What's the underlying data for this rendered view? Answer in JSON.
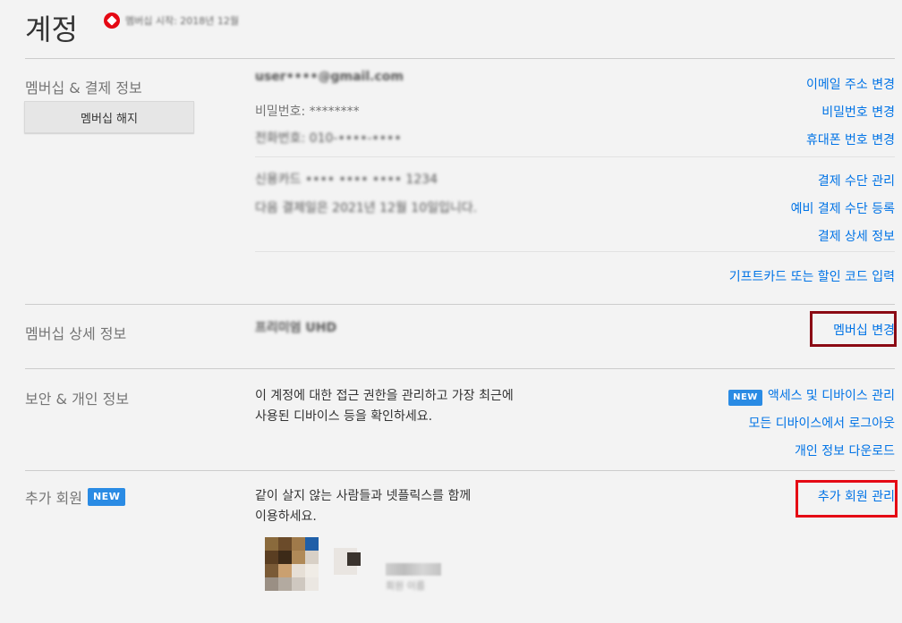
{
  "page": {
    "title": "계정",
    "member_since": "멤버십 시작: 2018년 12월"
  },
  "membership_billing": {
    "label": "멤버십 & 결제 정보",
    "cancel_button": "멤버십 해지",
    "email": "user••••@gmail.com",
    "password": "비밀번호: ********",
    "phone": "전화번호: 010-••••-••••",
    "card": "신용카드 •••• •••• •••• 1234",
    "next_billing": "다음 결제일은 2021년 12월 10일입니다.",
    "links": {
      "change_email": "이메일 주소 변경",
      "change_password": "비밀번호 변경",
      "change_phone": "휴대폰 번호 변경",
      "manage_payment": "결제 수단 관리",
      "backup_payment": "예비 결제 수단 등록",
      "billing_details": "결제 상세 정보",
      "gift_card": "기프트카드 또는 할인 코드 입력"
    }
  },
  "plan_details": {
    "label": "멤버십 상세 정보",
    "plan_value": "프리미엄 UHD",
    "change_plan": "멤버십 변경"
  },
  "security": {
    "label": "보안 & 개인 정보",
    "description_line1": "이 계정에 대한 접근 권한을 관리하고 가장 최근에",
    "description_line2": "사용된 디바이스 등을 확인하세요.",
    "new_badge": "NEW",
    "access_devices": "액세스 및 디바이스 관리",
    "sign_out_all": "모든 디바이스에서 로그아웃",
    "download_info": "개인 정보 다운로드"
  },
  "extra_member": {
    "label": "추가 회원",
    "new_badge": "NEW",
    "description_line1": "같이 살지 않는 사람들과 넷플릭스를 함께",
    "description_line2": "이용하세요.",
    "manage": "추가 회원 관리",
    "profile_name": "회원 이름"
  },
  "colors": {
    "accent_link": "#0073e6",
    "badge": "#2a8be4",
    "highlight_dark": "#8b0a14",
    "highlight_red": "#e50914"
  },
  "icons": {
    "brand_since": "membership-since-icon"
  }
}
